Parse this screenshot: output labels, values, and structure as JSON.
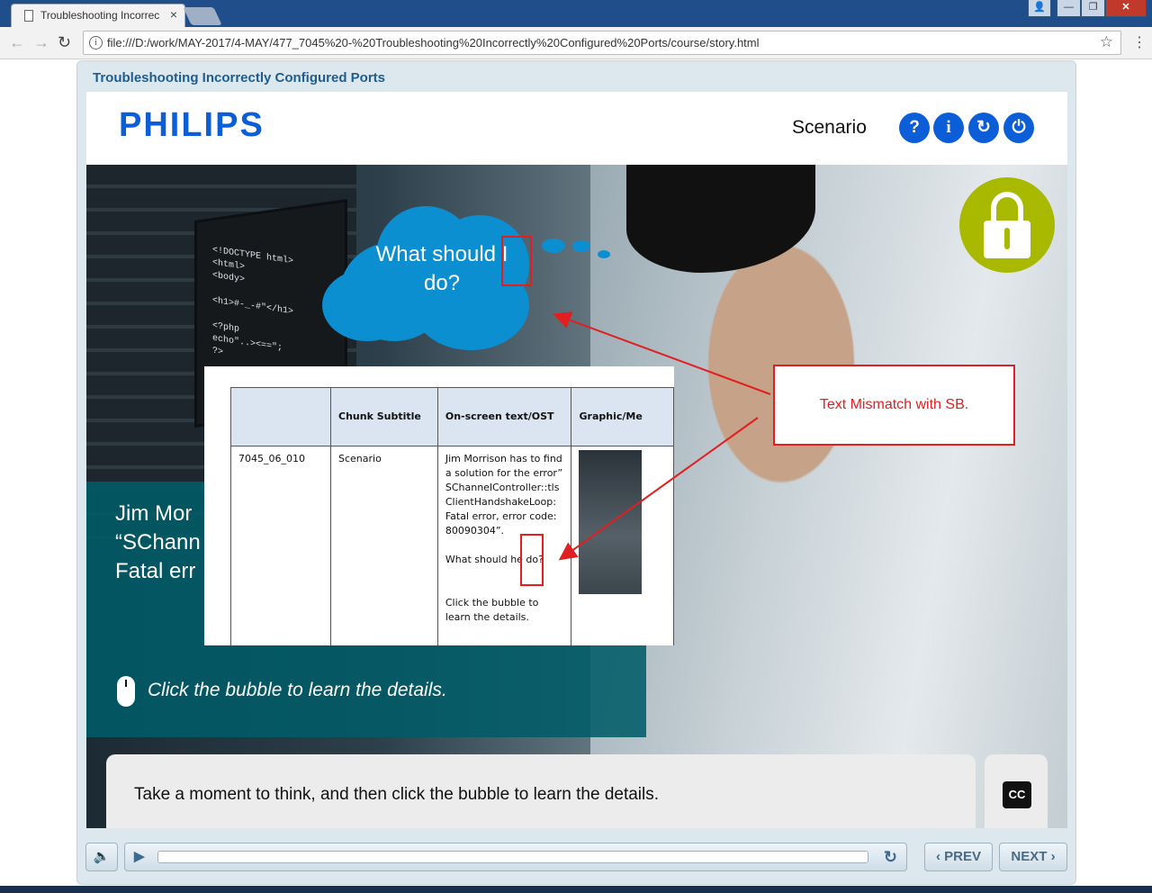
{
  "browser": {
    "tab_title": "Troubleshooting Incorrec",
    "tab_close": "×",
    "url": "file:///D:/work/MAY-2017/4-MAY/477_7045%20-%20Troubleshooting%20Incorrectly%20Configured%20Ports/course/story.html",
    "nav_back": "←",
    "nav_forward": "→",
    "nav_reload": "↻",
    "star": "☆",
    "menu": "⋮",
    "info": "i",
    "win_min": "—",
    "win_max": "❐",
    "win_close": "✕"
  },
  "course": {
    "title": "Troubleshooting Incorrectly Configured Ports",
    "logo": "PHILIPS",
    "section": "Scenario",
    "buttons": {
      "help": "?",
      "info": "i",
      "replay": "↻",
      "power": "⏻"
    }
  },
  "scene": {
    "code": "<!DOCTYPE html>\n<html>\n<body>\n\n<h1>#-_-#\"</h1>\n\n<?php\necho\"..><==\";\n?>",
    "bubble": "What should I do?",
    "teal_text": "Jim Mor\n“SChann\nFatal err",
    "hint": "Click the bubble to learn the details.",
    "caption": "Take a moment to think, and then click the bubble to learn the details.",
    "cc": "CC"
  },
  "storyboard": {
    "headers": [
      "",
      "Chunk Subtitle",
      "On-screen text/OST",
      "Graphic/Me"
    ],
    "row": {
      "id": "7045_06_010",
      "subtitle": "Scenario",
      "ost_1": "Jim Morrison has to find a solution for the error” SChannelController::tlsClientHandshakeLoop: Fatal error, error code: 80090304”.",
      "ost_2": "What should he do?",
      "ost_3": "Click the bubble to learn the details."
    }
  },
  "annotation": {
    "text": "Text Mismatch with SB.",
    "color": "#e02020"
  },
  "controls": {
    "prev": "‹ PREV",
    "next": "NEXT ›",
    "volume": "🔈",
    "play": "▶",
    "reload": "↻",
    "progress": 0
  },
  "colors": {
    "brand": "#0b5ed7",
    "teal": "#005c68",
    "bubble": "#0b8fd1",
    "lock": "#a9b900"
  }
}
